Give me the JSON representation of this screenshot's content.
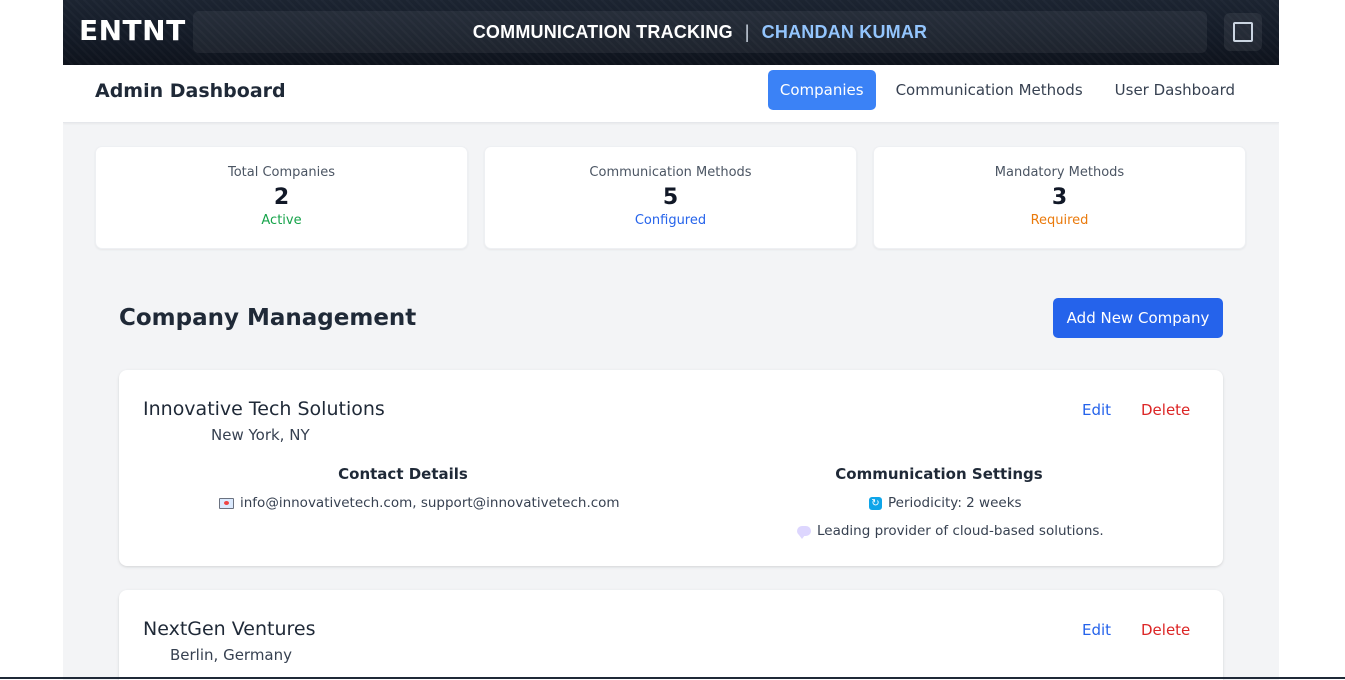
{
  "header": {
    "logo": "ENTNT",
    "title": "COMMUNICATION TRACKING",
    "separator": "|",
    "user": "CHANDAN KUMAR",
    "menu_icon": "square-icon"
  },
  "subnav": {
    "page_title": "Admin Dashboard",
    "tabs": [
      {
        "label": "Companies",
        "active": true
      },
      {
        "label": "Communication Methods",
        "active": false
      },
      {
        "label": "User Dashboard",
        "active": false
      }
    ]
  },
  "stats": [
    {
      "label": "Total Companies",
      "value": "2",
      "sub": "Active",
      "color": "#16a34a"
    },
    {
      "label": "Communication Methods",
      "value": "5",
      "sub": "Configured",
      "color": "#2563eb"
    },
    {
      "label": "Mandatory Methods",
      "value": "3",
      "sub": "Required",
      "color": "#ea7a0c"
    }
  ],
  "management": {
    "title": "Company Management",
    "add_button": "Add New Company"
  },
  "companies": [
    {
      "name": "Innovative Tech Solutions",
      "location": "New York, NY",
      "edit": "Edit",
      "delete": "Delete",
      "contact_title": "Contact Details",
      "emails": "info@innovativetech.com, support@innovativetech.com",
      "comm_title": "Communication Settings",
      "periodicity": "Periodicity: 2 weeks",
      "description": "Leading provider of cloud-based solutions."
    },
    {
      "name": "NextGen Ventures",
      "location": "Berlin, Germany",
      "edit": "Edit",
      "delete": "Delete"
    }
  ],
  "colors": {
    "primary": "#3b82f6",
    "button": "#2563eb",
    "danger": "#dc2626"
  }
}
